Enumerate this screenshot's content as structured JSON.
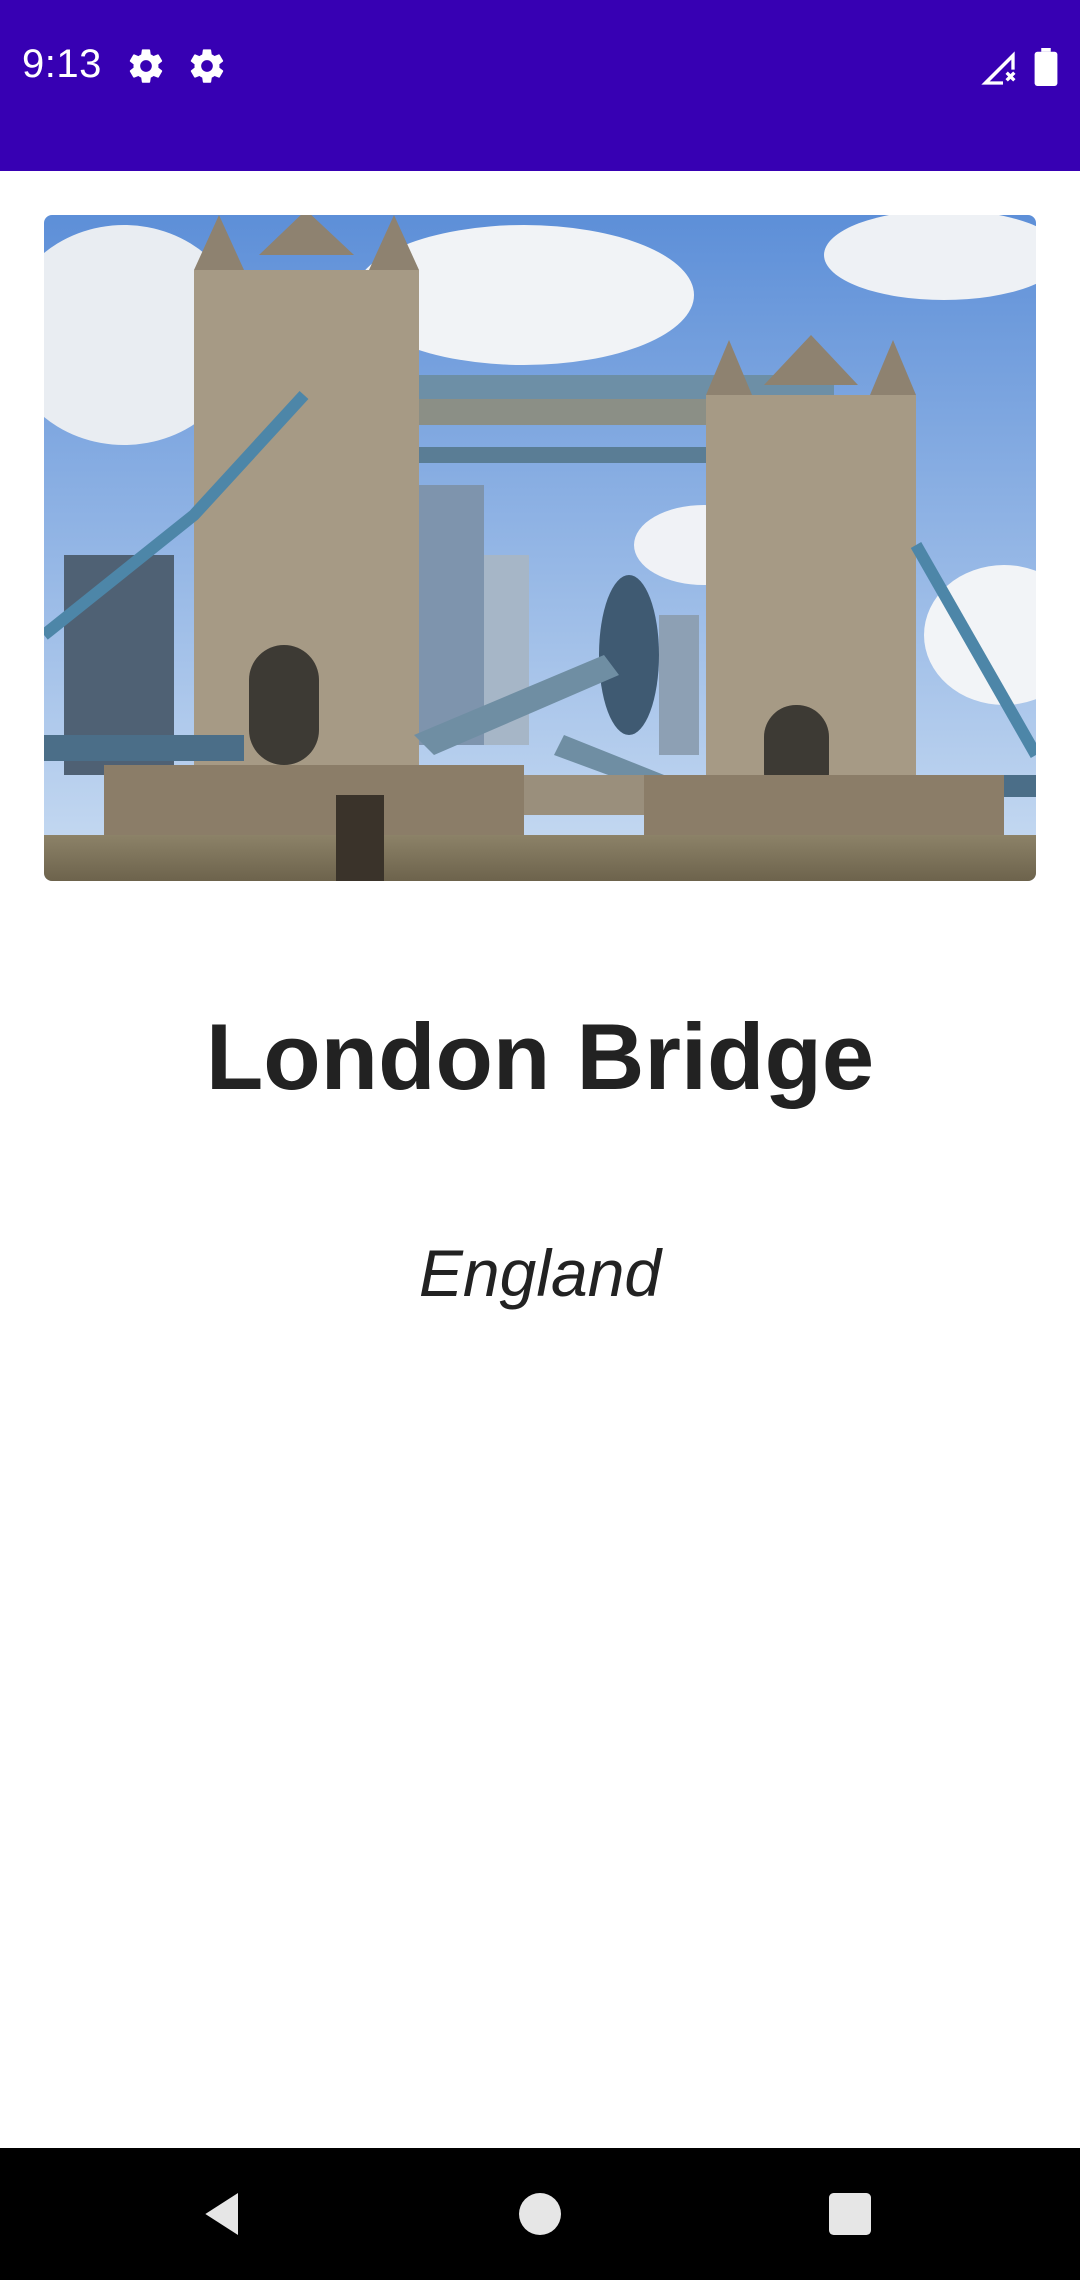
{
  "status_bar": {
    "time": "9:13",
    "background": "#3700b3",
    "icons": [
      "gear-icon",
      "gear-icon",
      "signal-icon",
      "battery-icon"
    ]
  },
  "content": {
    "title": "London Bridge",
    "subtitle": "England"
  },
  "nav_bar": {
    "buttons": [
      "back-icon",
      "home-icon",
      "recents-icon"
    ]
  }
}
